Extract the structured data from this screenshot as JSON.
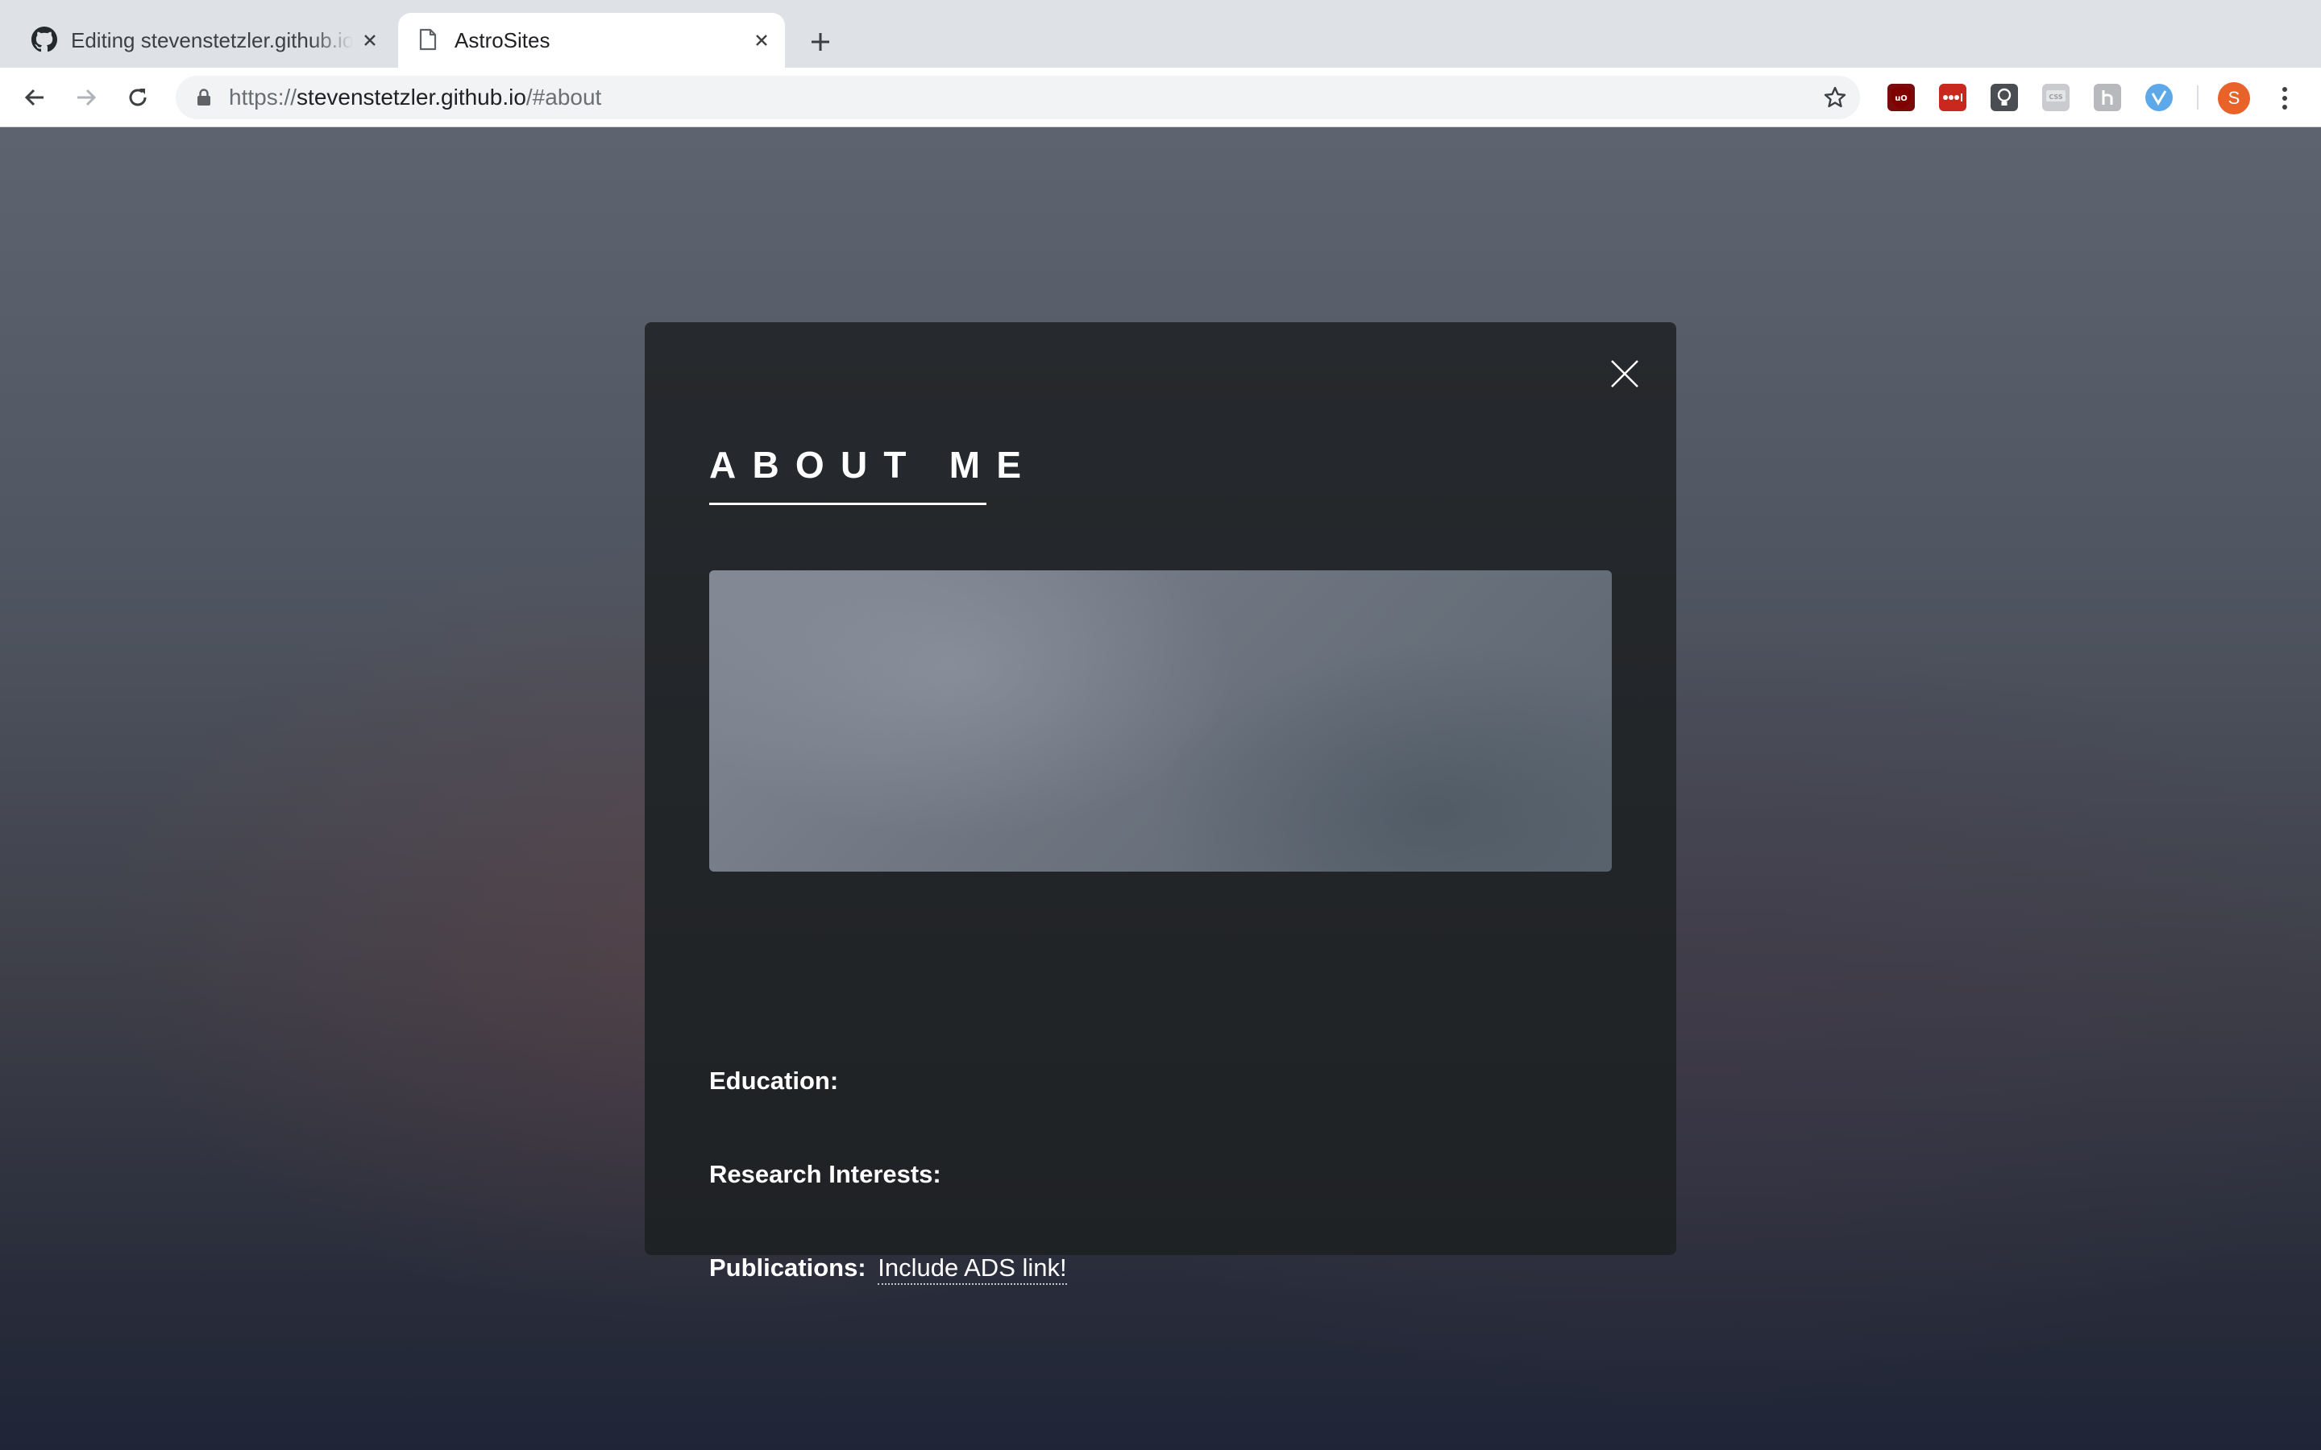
{
  "browser": {
    "tabs": [
      {
        "title": "Editing stevenstetzler.github.io",
        "icon": "github-icon",
        "active": false
      },
      {
        "title": "AstroSites",
        "icon": "page-icon",
        "active": true
      }
    ],
    "url": {
      "scheme": "https://",
      "host": "stevenstetzler.github.io",
      "path": "/#about"
    },
    "profile_initial": "S",
    "extensions": [
      "ublock-origin-icon",
      "lastpass-icon",
      "idea-icon",
      "css-icon",
      "hypothesis-icon",
      "vimium-icon"
    ]
  },
  "modal": {
    "title": "ABOUT ME",
    "education_label": "Education:",
    "research_label": "Research Interests:",
    "publications_label": "Publications:",
    "publications_link": "Include ADS link!"
  },
  "colors": {
    "modal_bg": "#26292d",
    "tabbar_bg": "#dee1e6",
    "avatar": "#e8622a"
  }
}
